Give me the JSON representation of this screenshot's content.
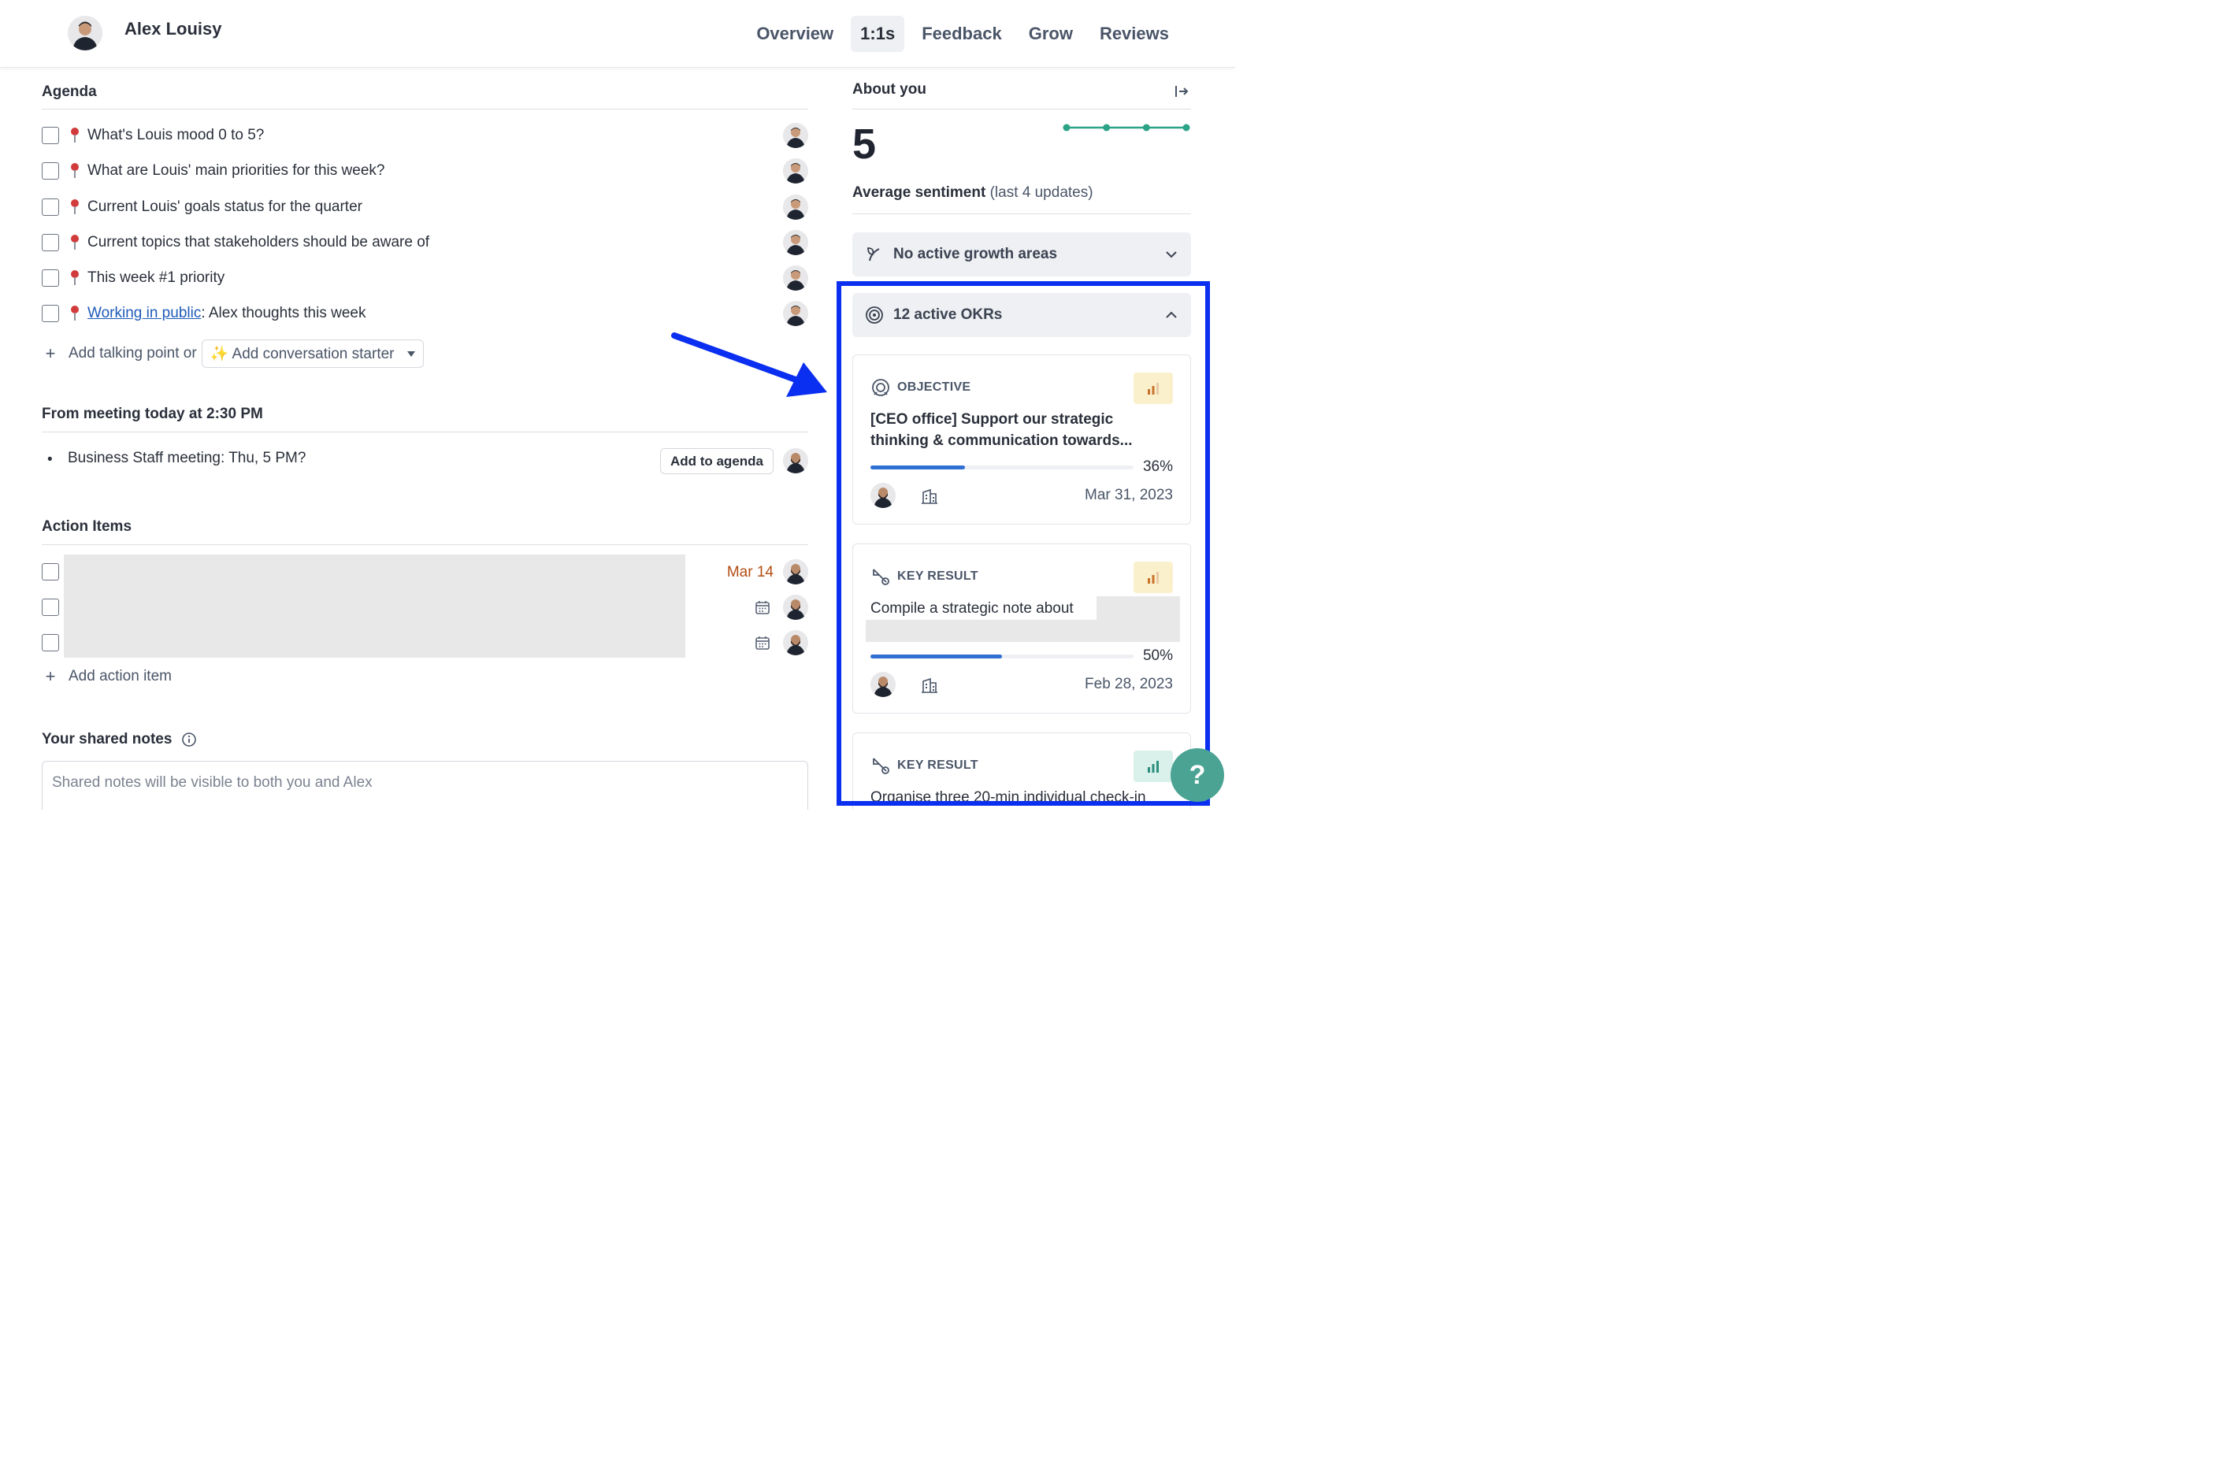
{
  "header": {
    "user_name": "Alex Louisy",
    "tabs": [
      {
        "label": "Overview",
        "active": false
      },
      {
        "label": "1:1s",
        "active": true
      },
      {
        "label": "Feedback",
        "active": false
      },
      {
        "label": "Grow",
        "active": false
      },
      {
        "label": "Reviews",
        "active": false
      }
    ]
  },
  "agenda": {
    "title": "Agenda",
    "items": [
      {
        "text": "What's Louis mood 0 to 5?"
      },
      {
        "text": "What are Louis' main priorities for this week?"
      },
      {
        "text": "Current Louis' goals status for the quarter"
      },
      {
        "text": "Current topics that stakeholders should be aware of"
      },
      {
        "text": "This week #1 priority"
      },
      {
        "link": "Working in public",
        "text": ": Alex thoughts this week"
      }
    ],
    "add_label": "Add talking point or",
    "starter_label": "✨ Add conversation starter"
  },
  "meeting": {
    "title": "From meeting today at 2:30 PM",
    "bullet": "•",
    "item": "Business Staff meeting: Thu, 5 PM?",
    "add_to_agenda": "Add to agenda"
  },
  "action_items": {
    "title": "Action Items",
    "items": [
      {
        "due": "Mar 14"
      },
      {
        "due": ""
      },
      {
        "due": ""
      }
    ],
    "add_label": "Add action item"
  },
  "notes": {
    "title": "Your shared notes",
    "placeholder": "Shared notes will be visible to both you and Alex"
  },
  "about": {
    "title": "About you",
    "score": "5",
    "avg_label": "Average sentiment",
    "avg_sub": "(last 4 updates)",
    "sentiment_values": [
      5,
      5,
      5,
      5
    ],
    "growth_label": "No active growth areas",
    "okr_label": "12 active OKRs"
  },
  "okrs": [
    {
      "kind": "OBJECTIVE",
      "title": "[CEO office] Support our strategic thinking & communication towards...",
      "progress_pct": 36,
      "pct_label": "36%",
      "date": "Mar 31, 2023",
      "badge_color": "#c8722c"
    },
    {
      "kind": "KEY RESULT",
      "title": "Compile a strategic note about",
      "progress_pct": 50,
      "pct_label": "50%",
      "date": "Feb 28, 2023",
      "badge_color": "#c8722c"
    },
    {
      "kind": "KEY RESULT",
      "title": "Organise three 20-min individual check-in",
      "badge_color": "#2a8f7d"
    }
  ],
  "colors": {
    "accent_blue": "#2f6fd1",
    "annotation_blue": "#0a2ff0",
    "sentiment_green": "#2aa386",
    "due_orange": "#b44d12",
    "help_teal": "#4aa393"
  },
  "help": {
    "symbol": "?"
  }
}
